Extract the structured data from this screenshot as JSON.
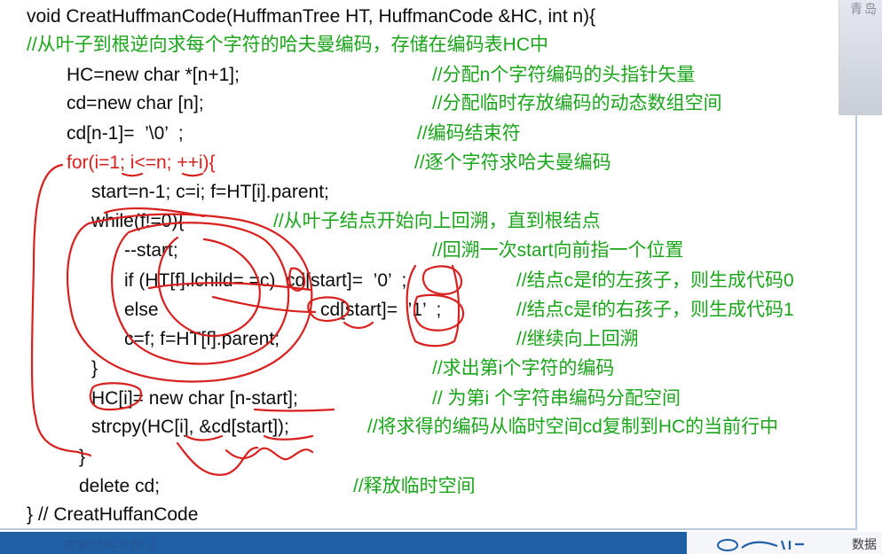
{
  "code": {
    "l1": {
      "text": "void CreatHuffmanCode(HuffmanTree HT, HuffmanCode &HC, int n){"
    },
    "l2": {
      "comment": "//从叶子到根逆向求每个字符的哈夫曼编码，存储在编码表HC中"
    },
    "l3": {
      "text": "HC=new char *[n+1];",
      "comment": "//分配n个字符编码的头指针矢量"
    },
    "l4": {
      "text": "cd=new char [n];",
      "comment": "//分配临时存放编码的动态数组空间"
    },
    "l5": {
      "text": "cd[n-1]=  ’\\0’  ;",
      "comment": "//编码结束符"
    },
    "l6": {
      "text": "for(i=1; i<=n; ++i){",
      "comment": "//逐个字符求哈夫曼编码"
    },
    "l7": {
      "text": "start=n-1; c=i; f=HT[i].parent;"
    },
    "l8": {
      "text": "while(f!=0){",
      "comment": "//从叶子结点开始向上回溯，直到根结点"
    },
    "l9": {
      "text": "--start;",
      "comment": "//回溯一次start向前指一个位置"
    },
    "l10": {
      "text": "if (HT[f].lchild= =c)  cd[start]=  ’0’  ;",
      "comment": "//结点c是f的左孩子，则生成代码0"
    },
    "l11": {
      "text": "else",
      "text2": "cd[start]=  ’1’  ;",
      "comment": "//结点c是f的右孩子，则生成代码1"
    },
    "l12": {
      "text": "c=f; f=HT[f].parent;",
      "comment": "//继续向上回溯"
    },
    "l13": {
      "text": "}",
      "comment": "//求出第i个字符的编码"
    },
    "l14": {
      "text": "HC[i]= new char [n-start];",
      "comment": "// 为第i 个字符串编码分配空间"
    },
    "l15": {
      "text": "strcpy(HC[i], &cd[start]);",
      "comment": "//将求得的编码从临时空间cd复制到HC的当前行中"
    },
    "l16": {
      "text": "}"
    },
    "l17": {
      "text": "delete cd;",
      "comment": "//释放临时空间"
    },
    "l18": {
      "text": "} // CreatHuffanCode"
    }
  },
  "camera": {
    "label": "青岛"
  },
  "footer": {
    "left_text": "数据结构与算法",
    "right_text": "数据"
  },
  "colors": {
    "code": "#0b0b0b",
    "comment": "#1aa51a",
    "for_keyword": "#d8211f",
    "annotation": "#d8211f",
    "footer_bar": "#1e5fa5"
  }
}
